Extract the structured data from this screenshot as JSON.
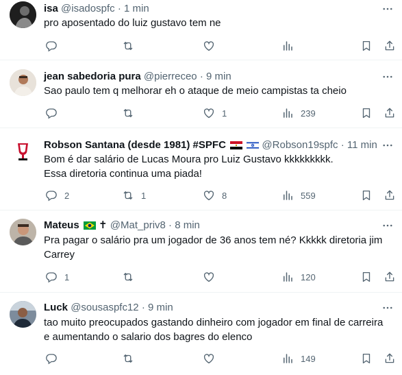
{
  "tweets": [
    {
      "name": "isa",
      "handle": "@isadospfc",
      "time": "1 min",
      "text": "pro aposentado do luiz gustavo tem ne",
      "replies": "",
      "retweets": "",
      "likes": "",
      "views": ""
    },
    {
      "name": "jean sabedoria pura",
      "handle": "@pierreceo",
      "time": "9 min",
      "text": "Sao paulo tem q melhorar eh o ataque de meio campistas ta cheio",
      "replies": "",
      "retweets": "",
      "likes": "1",
      "views": "239"
    },
    {
      "name": "Robson Santana (desde 1981) #SPFC",
      "handle": "@Robson19spfc",
      "time": "11 min",
      "text_line1": "Bom é dar salário de Lucas Moura pro Luiz Gustavo kkkkkkkkk.",
      "text_line2": "Essa diretoria continua uma piada!",
      "replies": "2",
      "retweets": "1",
      "likes": "8",
      "views": "559"
    },
    {
      "name": "Mateus",
      "name_suffix": "✝",
      "handle": "@Mat_priv8",
      "time": "8 min",
      "text_line1": "Pra pagar o salário pra um jogador de 36 anos tem né? Kkkkk diretoria jim",
      "text_line2": "Carrey",
      "replies": "1",
      "retweets": "",
      "likes": "",
      "views": "120"
    },
    {
      "name": "Luck",
      "handle": "@sousaspfc12",
      "time": "9 min",
      "text_line1": "tao muito preocupados gastando dinheiro com jogador em final de carreira",
      "text_line2": "e aumentando o salario dos bagres do elenco",
      "replies": "",
      "retweets": "",
      "likes": "",
      "views": "149"
    }
  ],
  "separator": "·",
  "icons": {
    "reply": "reply-icon",
    "retweet": "retweet-icon",
    "like": "heart-icon",
    "views": "views-icon",
    "bookmark": "bookmark-icon",
    "share": "share-icon",
    "more": "more-icon"
  },
  "colors": {
    "text": "#0f1419",
    "secondary": "#536471",
    "border": "#eff3f4"
  }
}
